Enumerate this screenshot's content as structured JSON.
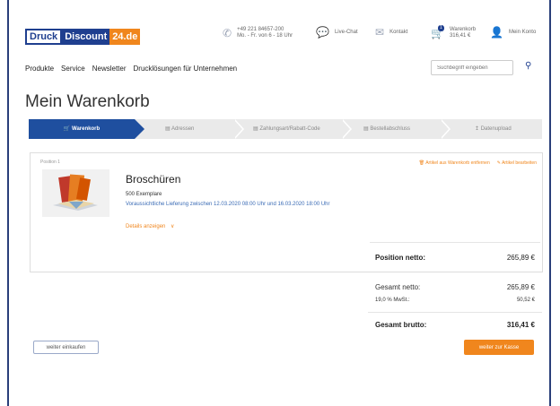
{
  "header": {
    "logo": {
      "part1": "Druck",
      "part2": "Discount",
      "part3": "24.de"
    },
    "phone": {
      "number": "+49 221 84657-200",
      "hours": "Mo. - Fr. von 6 - 18 Uhr"
    },
    "live_chat": "Live-Chat",
    "contact": "Kontakt",
    "cart": {
      "label": "Warenkorb",
      "amount": "316,41 €",
      "count": "1"
    },
    "account": "Mein Konto"
  },
  "nav": {
    "items": [
      "Produkte",
      "Service",
      "Newsletter",
      "Drucklösungen für Unternehmen"
    ]
  },
  "search": {
    "placeholder": "Suchbegriff eingeben"
  },
  "page_title": "Mein Warenkorb",
  "steps": [
    "Warenkorb",
    "Adressen",
    "Zahlungsart/Rabatt-Code",
    "Bestellabschluss",
    "Datenupload"
  ],
  "position": {
    "label": "Position 1",
    "title": "Broschüren",
    "quantity": "500 Exemplare",
    "delivery": "Voraussichtliche Lieferung zwischen 12.03.2020 08:00 Uhr und 16.03.2020 18:00 Uhr",
    "details": "Details anzeigen",
    "remove": "Artikel aus Warenkorb entfernen",
    "edit": "Artikel bearbeiten",
    "netto_label": "Position netto:",
    "netto_value": "265,89 €"
  },
  "totals": {
    "netto_label": "Gesamt netto:",
    "netto_value": "265,89 €",
    "vat_label": "19,0 % MwSt.:",
    "vat_value": "50,52 €",
    "brutto_label": "Gesamt brutto:",
    "brutto_value": "316,41 €"
  },
  "buttons": {
    "continue_shopping": "weiter einkaufen",
    "checkout": "weiter zur Kasse"
  },
  "colors": {
    "brand_blue": "#1f4f9f",
    "accent_orange": "#f0861d"
  }
}
